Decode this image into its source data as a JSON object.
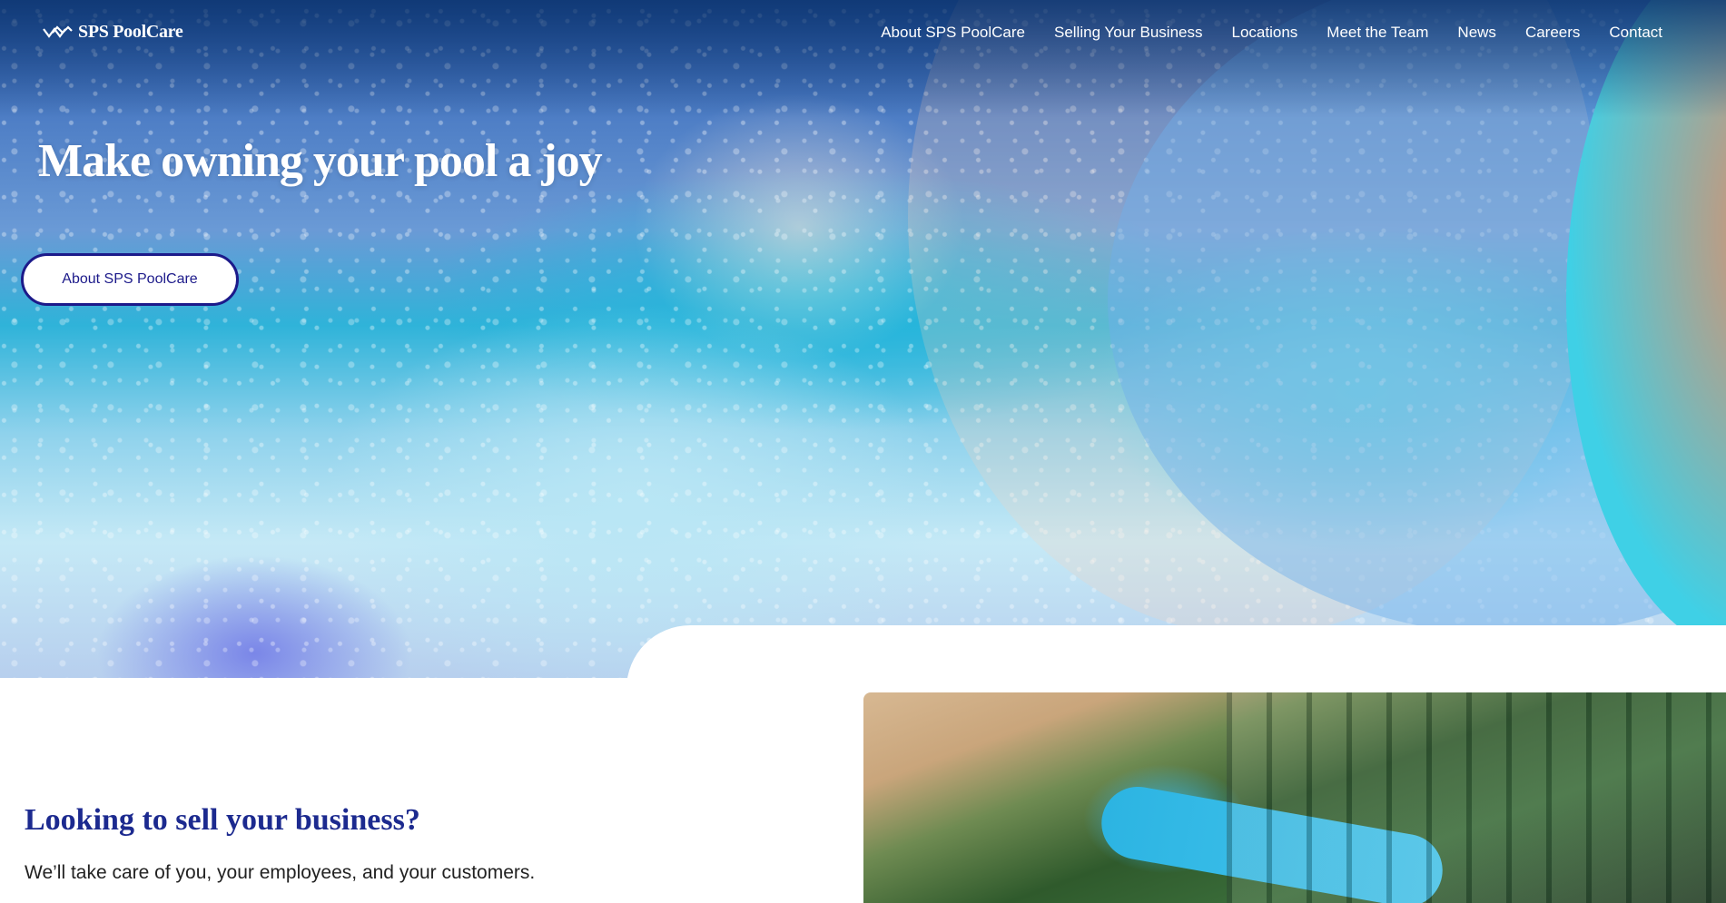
{
  "brand": {
    "name": "SPS PoolCare",
    "logo_icon": "sps-wave-logo"
  },
  "nav": {
    "items": [
      {
        "label": "About SPS PoolCare"
      },
      {
        "label": "Selling Your Business"
      },
      {
        "label": "Locations"
      },
      {
        "label": "Meet the Team"
      },
      {
        "label": "News"
      },
      {
        "label": "Careers"
      },
      {
        "label": "Contact"
      }
    ]
  },
  "hero": {
    "title": "Make owning your pool a joy",
    "button_label": "About SPS PoolCare"
  },
  "sell_section": {
    "title": "Looking to sell your business?",
    "subtitle": "We’ll take care of you, your employees, and your customers."
  },
  "colors": {
    "brand_navy": "#1c2a8f",
    "button_border": "#1c1a8a",
    "white": "#ffffff"
  }
}
